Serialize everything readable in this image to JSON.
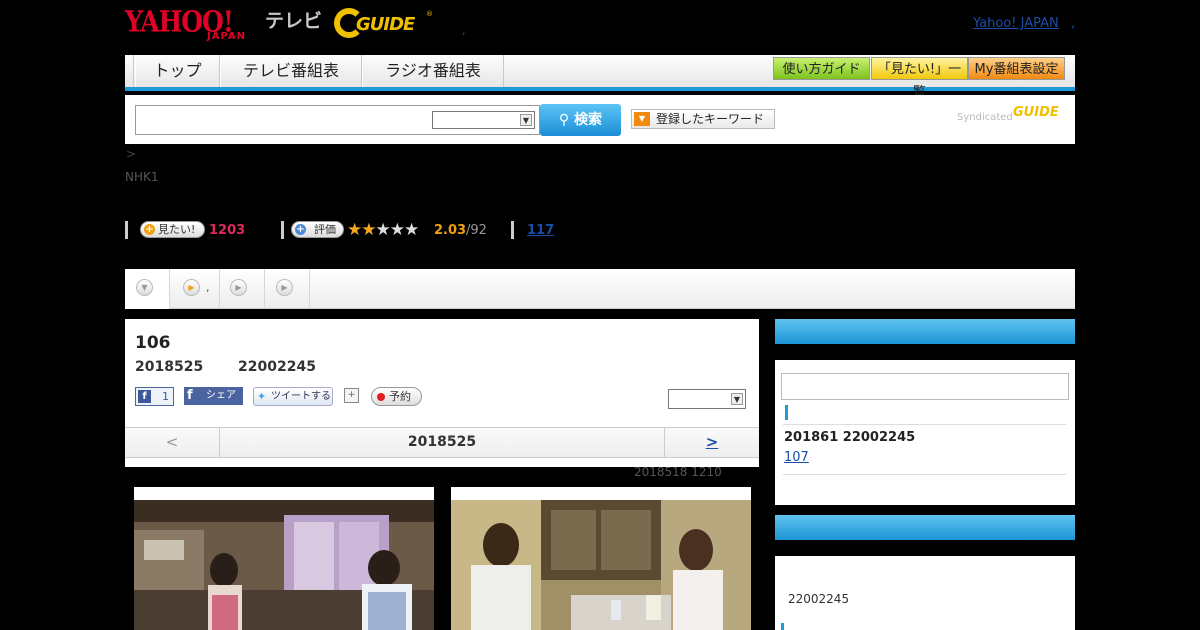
{
  "header": {
    "yahoo_logo_text": "YAHOO!",
    "yahoo_logo_sub": "JAPAN",
    "tv_label": "テレビ",
    "gguide_logo_text": "GUIDE",
    "gguide_reg": "®",
    "dot": ",",
    "yahoo_japan_link": "Yahoo! JAPAN",
    "yahoo_japan_dot": ","
  },
  "nav": {
    "tabs": [
      "トップ",
      "テレビ番組表",
      "ラジオ番組表"
    ],
    "buttons": [
      "使い方ガイド",
      "「見たい!」一覧",
      "My番組表設定"
    ]
  },
  "search": {
    "input_value": "",
    "select_value": "",
    "search_button": "検索",
    "keyword_button": "登録したキーワード",
    "syndicated_label": "Syndicated",
    "syndicated_logo": "GUIDE"
  },
  "breadcrumb": ">",
  "channel": "NHK1",
  "stats": {
    "mitai_label": "見たい!",
    "mitai_count": "1203",
    "rating_label": "評価",
    "rating_stars": 2,
    "rating_score": "2.03",
    "rating_count": "/92",
    "review_count": "117"
  },
  "subtabs": {
    "tab2_text": ","
  },
  "episode": {
    "number": "106",
    "date": "2018525",
    "time": "22002245",
    "fb_like_count": "1",
    "fb_share_label": "シェア",
    "tweet_label": "ツイートする",
    "reserve_label": "予約",
    "select_value": "",
    "pager_prev": "<",
    "pager_current": "2018525",
    "pager_next": ">",
    "updated": "2018518  1210"
  },
  "sidebar": {
    "card1": {
      "input_value": "",
      "date_time": "201861  22002245",
      "link_text": "107"
    },
    "card2": {
      "time": "22002245"
    }
  },
  "colors": {
    "accent_blue": "#1e9ad8",
    "yahoo_red": "#e00028",
    "gguide_yellow": "#f0c000",
    "mitai_red": "#e0285a",
    "star": "#f5a623"
  }
}
